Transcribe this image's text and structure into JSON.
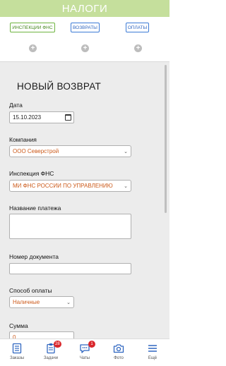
{
  "header": {
    "title": "НАЛОГИ"
  },
  "tabs": [
    {
      "label": "ИНСПЕКЦИИ ФНС"
    },
    {
      "label": "ВОЗВРАТЫ"
    },
    {
      "label": "ОПЛАТЫ"
    }
  ],
  "form": {
    "title": "НОВЫЙ ВОЗВРАТ",
    "date_label": "Дата",
    "date_value": "15.10.2023",
    "company_label": "Компания",
    "company_value": "ООО Северстрой",
    "inspection_label": "Инспекция ФНС",
    "inspection_value": "МИ ФНС РОССИИ ПО УПРАВЛЕНИЮ",
    "payment_name_label": "Название платежа",
    "payment_name_value": "",
    "doc_number_label": "Номер документа",
    "doc_number_value": "",
    "payment_method_label": "Способ оплаты",
    "payment_method_value": "Наличные",
    "sum_label": "Сумма",
    "sum_value": "0"
  },
  "bottom_nav": [
    {
      "label": "Заказы",
      "icon": "orders-icon"
    },
    {
      "label": "Задачи",
      "icon": "tasks-icon",
      "badge": "28"
    },
    {
      "label": "Чаты",
      "icon": "chat-icon",
      "badge": "1"
    },
    {
      "label": "Фото",
      "icon": "camera-icon"
    },
    {
      "label": "Ещё",
      "icon": "menu-icon"
    }
  ],
  "colors": {
    "header_bg": "#c5df9c",
    "tab_green": "#6db33f",
    "tab_blue": "#3b7ad6",
    "select_text": "#cc5a1a",
    "nav_icon": "#2f66c0",
    "badge": "#d9262b"
  }
}
